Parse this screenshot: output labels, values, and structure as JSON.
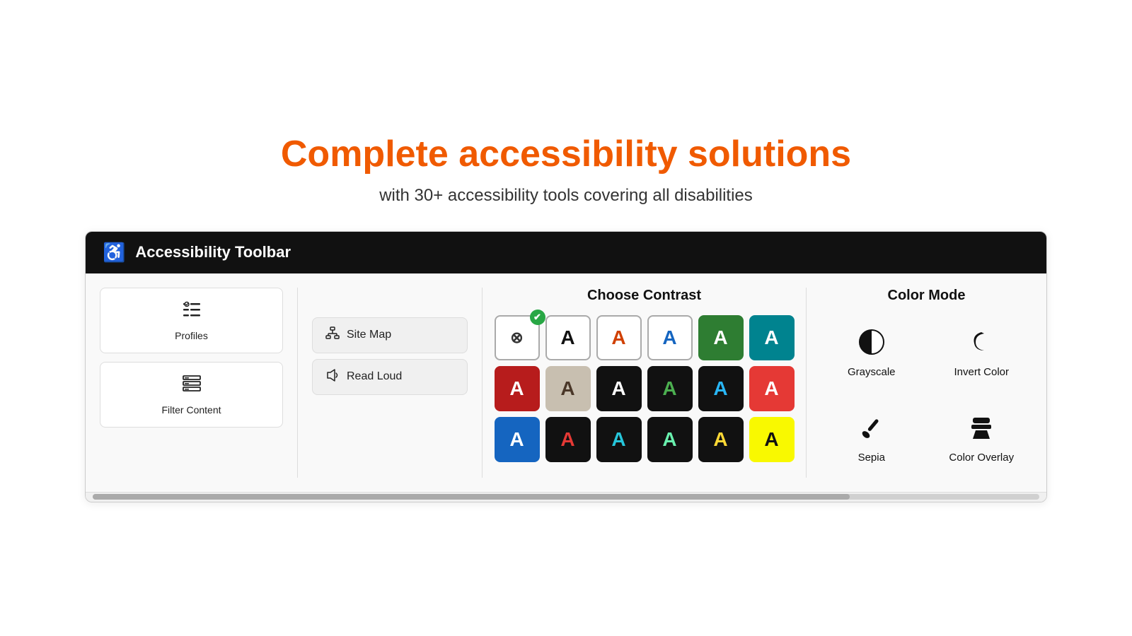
{
  "hero": {
    "title": "Complete accessibility solutions",
    "subtitle": "with 30+ accessibility tools covering all disabilities"
  },
  "toolbar": {
    "header": {
      "icon": "♿",
      "title": "Accessibility Toolbar"
    },
    "left": {
      "items": [
        {
          "id": "profiles",
          "icon": "☰✓",
          "label": "Profiles"
        },
        {
          "id": "filter-content",
          "icon": "▦",
          "label": "Filter Content"
        }
      ]
    },
    "menu": {
      "items": [
        {
          "id": "site-map",
          "icon": "⊞",
          "label": "Site Map"
        },
        {
          "id": "read-loud",
          "icon": "🔊",
          "label": "Read Loud"
        }
      ]
    },
    "contrast": {
      "title": "Choose Contrast",
      "buttons": [
        {
          "id": "default",
          "class": "cb-default",
          "text": "⊗",
          "active": true
        },
        {
          "id": "dark-a",
          "class": "cb-default",
          "text": "A"
        },
        {
          "id": "orange-a",
          "class": "cb-orange",
          "text": "A"
        },
        {
          "id": "blue-a",
          "class": "cb-blue",
          "text": "A"
        },
        {
          "id": "green-a",
          "class": "cb-green-bg",
          "text": "A"
        },
        {
          "id": "teal-a",
          "class": "cb-teal-bg",
          "text": "A"
        },
        {
          "id": "red-a",
          "class": "cb-red-on-white",
          "text": "A"
        },
        {
          "id": "tan-a",
          "class": "cb-tan-bg",
          "text": "A"
        },
        {
          "id": "black-a",
          "class": "cb-black-bg",
          "text": "A"
        },
        {
          "id": "green-black-a",
          "class": "cb-green-on-black",
          "text": "A"
        },
        {
          "id": "blue-black-a",
          "class": "cb-blue-on-black",
          "text": "A"
        },
        {
          "id": "red-black-a",
          "class": "cb-red-on-black",
          "text": "A"
        },
        {
          "id": "blue-bg-a",
          "class": "cb-blue-bg",
          "text": "A"
        },
        {
          "id": "red-dark-a",
          "class": "cb-red-on-darkbg",
          "text": "A"
        },
        {
          "id": "cyan-black-a",
          "class": "cb-cyan-on-black",
          "text": "A"
        },
        {
          "id": "lime-black-a",
          "class": "cb-lime-on-black",
          "text": "A"
        },
        {
          "id": "yellow-black-a",
          "class": "cb-yellow-on-black",
          "text": "A"
        },
        {
          "id": "yellow-yellow-a",
          "class": "cb-yellow-on-yellow",
          "text": "A"
        }
      ]
    },
    "colorMode": {
      "title": "Color Mode",
      "items": [
        {
          "id": "grayscale",
          "label": "Grayscale",
          "icon_type": "half-circle"
        },
        {
          "id": "invert-color",
          "label": "Invert Color",
          "icon_type": "moon"
        },
        {
          "id": "sepia",
          "label": "Sepia",
          "icon_type": "brush"
        },
        {
          "id": "color-overlay",
          "label": "Color Overlay",
          "icon_type": "paint"
        }
      ]
    }
  }
}
